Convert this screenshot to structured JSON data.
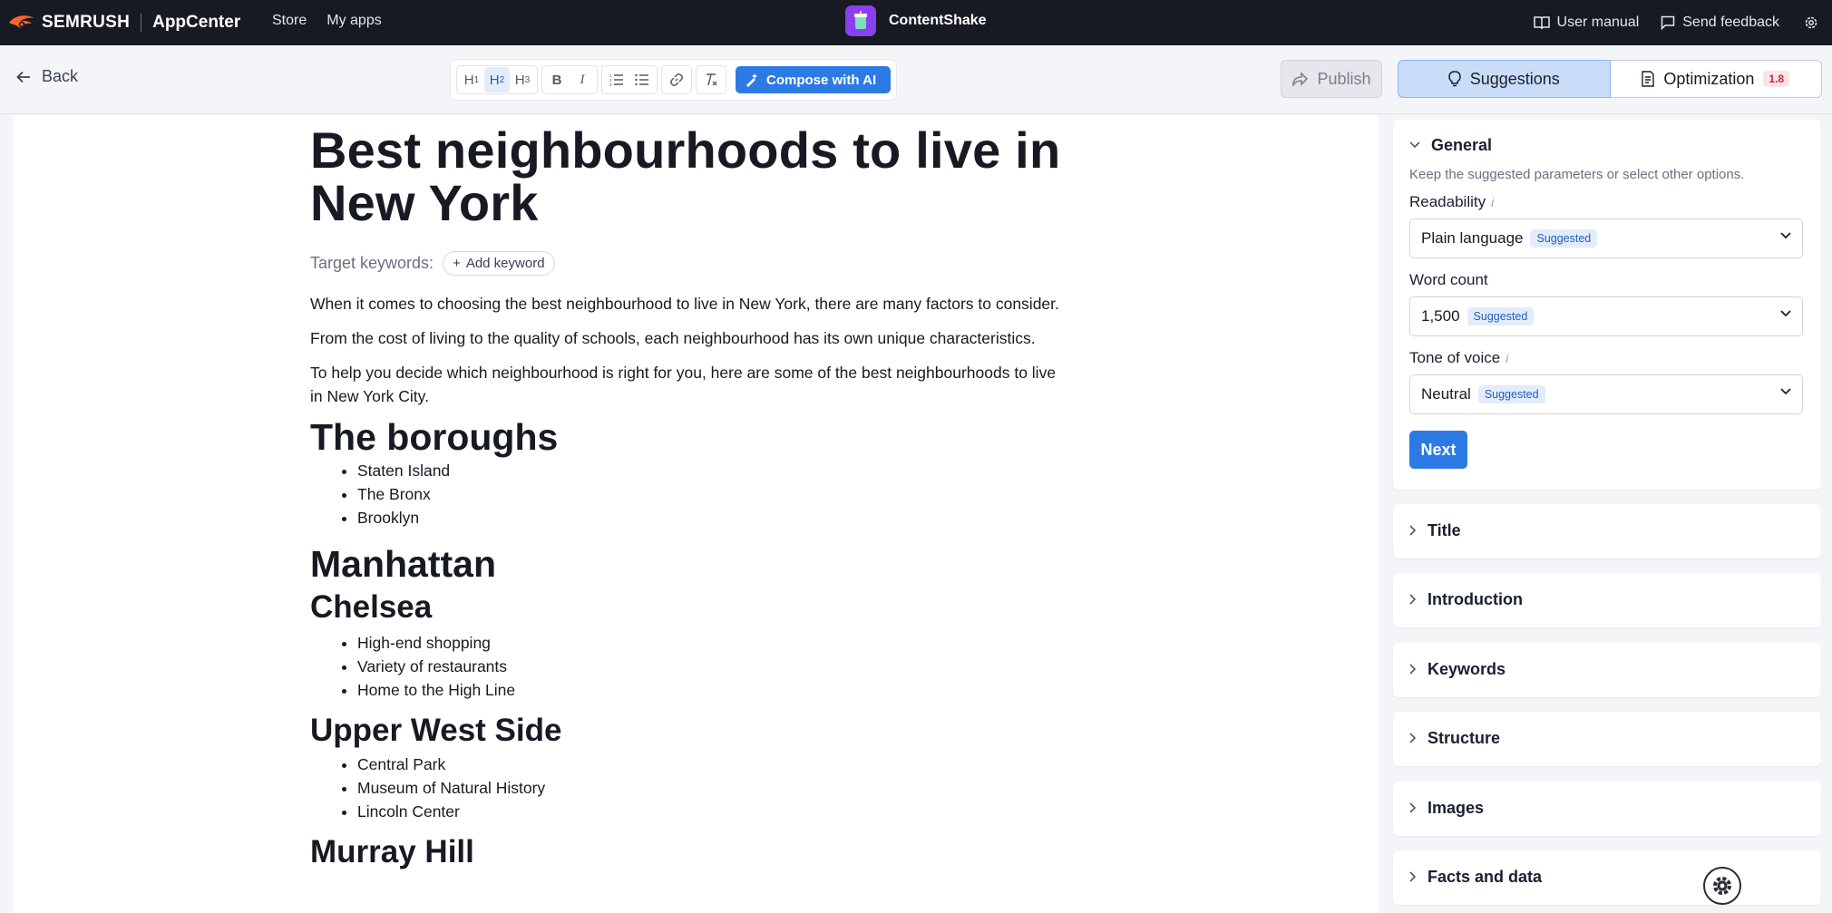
{
  "topbar": {
    "brand": "SEMRUSH",
    "brand_app": "AppCenter",
    "nav": [
      "Store",
      "My apps"
    ],
    "app_name": "ContentShake",
    "user_manual": "User manual",
    "send_feedback": "Send feedback"
  },
  "toolbar": {
    "back": "Back",
    "compose": "Compose with AI",
    "publish": "Publish",
    "tab_suggestions": "Suggestions",
    "tab_optimization": "Optimization",
    "optimization_score": "1.8"
  },
  "doc": {
    "title": "Best neighbourhoods to live in New York",
    "target_keywords_label": "Target keywords:",
    "add_keyword": "Add keyword",
    "paragraphs": [
      "When it comes to choosing the best neighbourhood to live in New York, there are many factors to consider.",
      "From the cost of living to the quality of schools, each neighbourhood has its own unique characteristics.",
      "To help you decide which neighbourhood is right for you, here are some of the best neighbourhoods to live in New York City."
    ],
    "h_boroughs": "The boroughs",
    "boroughs": [
      "Staten Island",
      "The Bronx",
      "Brooklyn"
    ],
    "h_manhattan": "Manhattan",
    "h_chelsea": "Chelsea",
    "chelsea": [
      "High-end shopping",
      "Variety of restaurants",
      "Home to the High Line"
    ],
    "h_uws": "Upper West Side",
    "uws": [
      "Central Park",
      "Museum of Natural History",
      "Lincoln Center"
    ],
    "h_murray": "Murray Hill"
  },
  "panel": {
    "general": {
      "title": "General",
      "desc": "Keep the suggested parameters or select other options.",
      "readability_label": "Readability",
      "readability_value": "Plain language",
      "word_count_label": "Word count",
      "word_count_value": "1,500",
      "tone_label": "Tone of voice",
      "tone_value": "Neutral",
      "suggested": "Suggested",
      "next": "Next"
    },
    "sections": [
      "Title",
      "Introduction",
      "Keywords",
      "Structure",
      "Images",
      "Facts and data"
    ]
  },
  "colors": {
    "accent": "#2c7be5",
    "topbar": "#171a22",
    "brand_orange": "#ff642d",
    "app_icon": "#8a3ff0"
  }
}
